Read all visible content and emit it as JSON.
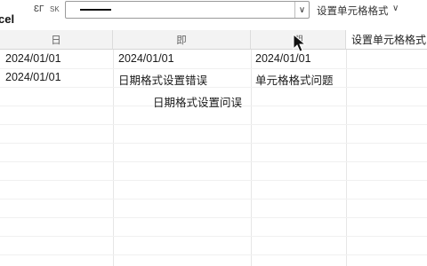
{
  "app_title": "cel",
  "toolbar": {
    "icon_a": "ƐГ",
    "icon_b": "SK",
    "format_label": "设置单元格格式",
    "format_chevron": "∨"
  },
  "columns": [
    {
      "header": "日"
    },
    {
      "header": "即"
    },
    {
      "header": "期"
    },
    {
      "header": "设置单元格格式"
    }
  ],
  "rows": [
    {
      "c1": "2024/01/01",
      "c2": "2024/01/01",
      "c3": "2024/01/01"
    },
    {
      "c1": "2024/01/01",
      "c2": "日期格式设置错误",
      "c3": "单元格格式问题"
    },
    {
      "c2": "日期格式设置问误"
    }
  ],
  "colors": {
    "header_bg": "#f3f3f3",
    "grid_line": "#e6e6e6"
  }
}
